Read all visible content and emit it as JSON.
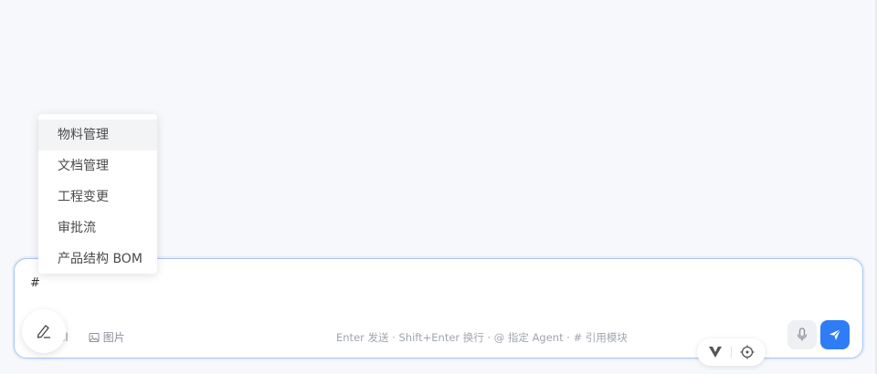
{
  "dropdown": {
    "items": [
      {
        "label": "物料管理",
        "active": true
      },
      {
        "label": "文档管理",
        "active": false
      },
      {
        "label": "工程变更",
        "active": false
      },
      {
        "label": "审批流",
        "active": false
      },
      {
        "label": "产品结构 BOM",
        "active": false
      }
    ]
  },
  "composer": {
    "input_value": "#",
    "toolbar": {
      "excel_label": "el",
      "image_label": "图片"
    },
    "hint": "Enter 发送 · Shift+Enter 换行 · @ 指定 Agent · # 引用模块"
  },
  "colors": {
    "accent": "#2f7df6",
    "border": "#a9c6f3"
  },
  "icons": [
    "pen-icon",
    "image-icon",
    "mic-icon",
    "send-icon",
    "logo-v-icon",
    "target-icon"
  ]
}
